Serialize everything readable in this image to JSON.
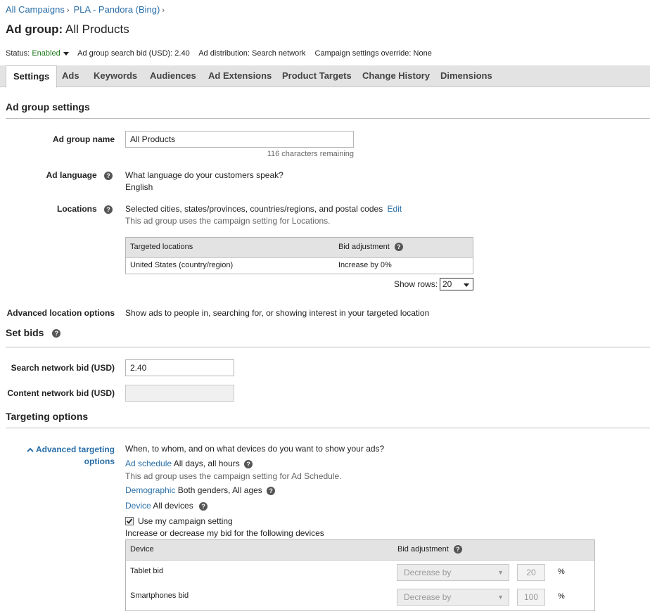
{
  "breadcrumb": {
    "items": [
      "All Campaigns",
      "PLA - Pandora (Bing)"
    ],
    "separator": "›"
  },
  "page": {
    "title_prefix": "Ad group:",
    "title_name": "All Products"
  },
  "status_bar": {
    "status_label": "Status:",
    "status_value": "Enabled",
    "search_bid": "Ad group search bid (USD): 2.40",
    "distribution": "Ad distribution: Search network",
    "override": "Campaign settings override: None"
  },
  "tabs": [
    "Settings",
    "Ads",
    "Keywords",
    "Audiences",
    "Ad Extensions",
    "Product Targets",
    "Change History",
    "Dimensions"
  ],
  "ad_group_settings": {
    "heading": "Ad group settings",
    "name_label": "Ad group name",
    "name_value": "All Products",
    "chars_remaining": "116 characters remaining",
    "language_label": "Ad language",
    "language_question": "What language do your customers speak?",
    "language_value": "English",
    "locations_label": "Locations",
    "locations_text": "Selected cities, states/provinces, countries/regions, and postal codes",
    "locations_edit": "Edit",
    "locations_note": "This ad group uses the campaign setting for Locations.",
    "locations_table": {
      "headers": [
        "Targeted locations",
        "Bid adjustment"
      ],
      "rows": [
        [
          "United States (country/region)",
          "Increase by 0%"
        ]
      ]
    },
    "show_rows_label": "Show  rows:",
    "show_rows_value": "20",
    "adv_location_label": "Advanced location options",
    "adv_location_text": "Show ads to people in, searching for, or showing interest in your targeted location"
  },
  "set_bids": {
    "heading": "Set bids",
    "search_label": "Search network bid (USD)",
    "search_value": "2.40",
    "content_label": "Content network bid (USD)",
    "content_value": ""
  },
  "targeting": {
    "heading": "Targeting options",
    "advanced_link_line1": "Advanced targeting",
    "advanced_link_line2": "options",
    "question": "When, to whom, and on what devices do you want to show your ads?",
    "schedule_link": "Ad schedule",
    "schedule_value": "All days, all hours",
    "schedule_note": "This ad group uses the campaign setting for Ad Schedule.",
    "demographic_link": "Demographic",
    "demographic_value": "Both genders, All ages",
    "device_link": "Device",
    "device_value": "All devices",
    "use_campaign_setting": "Use my campaign setting",
    "use_campaign_checked": true,
    "increase_note": "Increase or decrease my bid for the following devices",
    "device_table": {
      "headers": [
        "Device",
        "Bid adjustment"
      ],
      "rows": [
        {
          "device": "Tablet bid",
          "direction": "Decrease by",
          "value": "20",
          "unit": "%"
        },
        {
          "device": "Smartphones bid",
          "direction": "Decrease by",
          "value": "100",
          "unit": "%"
        }
      ]
    }
  },
  "colors": {
    "link": "#2a6fa8",
    "enabled": "#1f7a1f",
    "tab_bg": "#e3e3e3"
  },
  "icons": {
    "help": "question-circle-icon",
    "collapse": "chevron-up-icon",
    "dropdown": "caret-down-icon",
    "check": "checkbox-checked-icon"
  }
}
